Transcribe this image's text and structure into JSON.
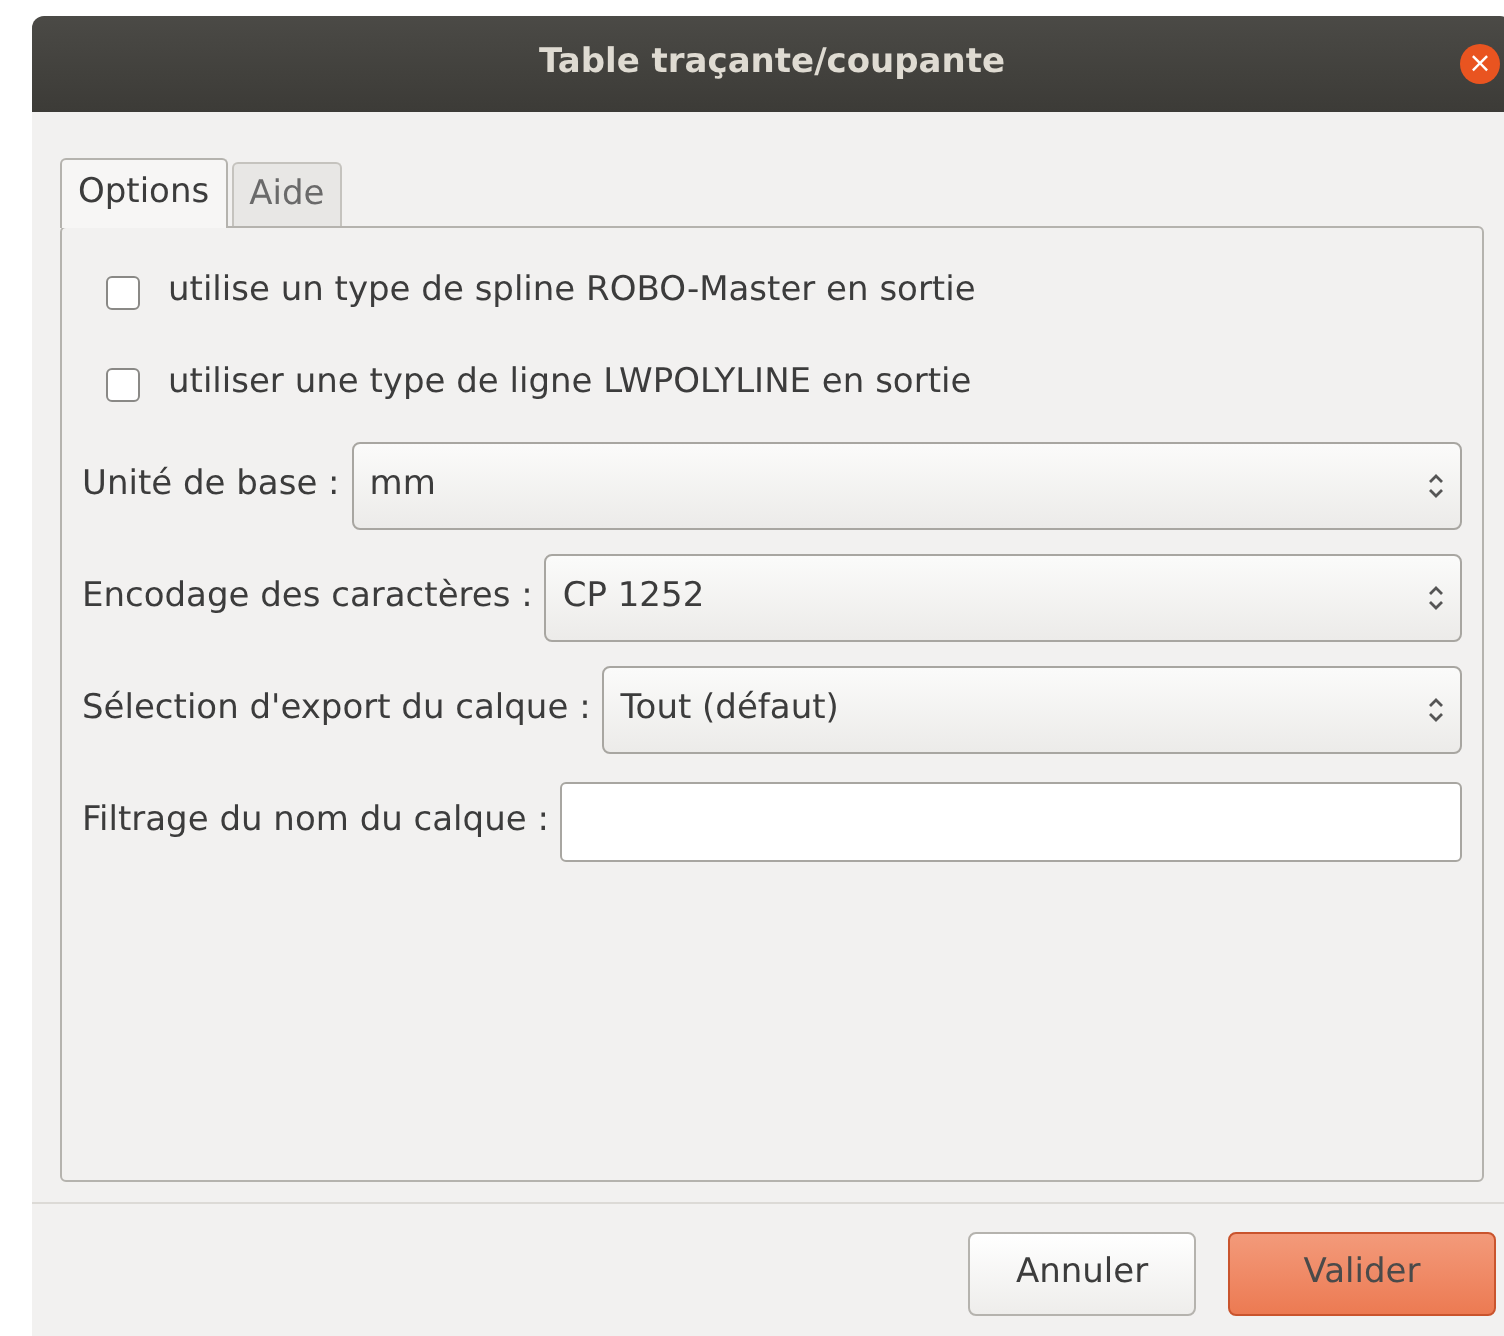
{
  "window": {
    "title": "Table traçante/coupante",
    "close": "×"
  },
  "tabs": [
    {
      "label": "Options",
      "selected": true
    },
    {
      "label": "Aide",
      "selected": false
    }
  ],
  "checkboxes": [
    {
      "label": "utilise un type de spline ROBO-Master en sortie",
      "checked": false
    },
    {
      "label": "utiliser une type de ligne LWPOLYLINE en sortie",
      "checked": false
    }
  ],
  "fields": [
    {
      "kind": "select",
      "label": "Unité de base :",
      "value": "mm"
    },
    {
      "kind": "select",
      "label": "Encodage des caractères :",
      "value": "CP 1252"
    },
    {
      "kind": "select",
      "label": "Sélection d'export du calque :",
      "value": "Tout (défaut)"
    },
    {
      "kind": "text",
      "label": "Filtrage du nom du calque :"
    }
  ],
  "buttons": [
    {
      "label": "Annuler",
      "kind": "normal"
    },
    {
      "label": "Valider",
      "kind": "default"
    }
  ]
}
